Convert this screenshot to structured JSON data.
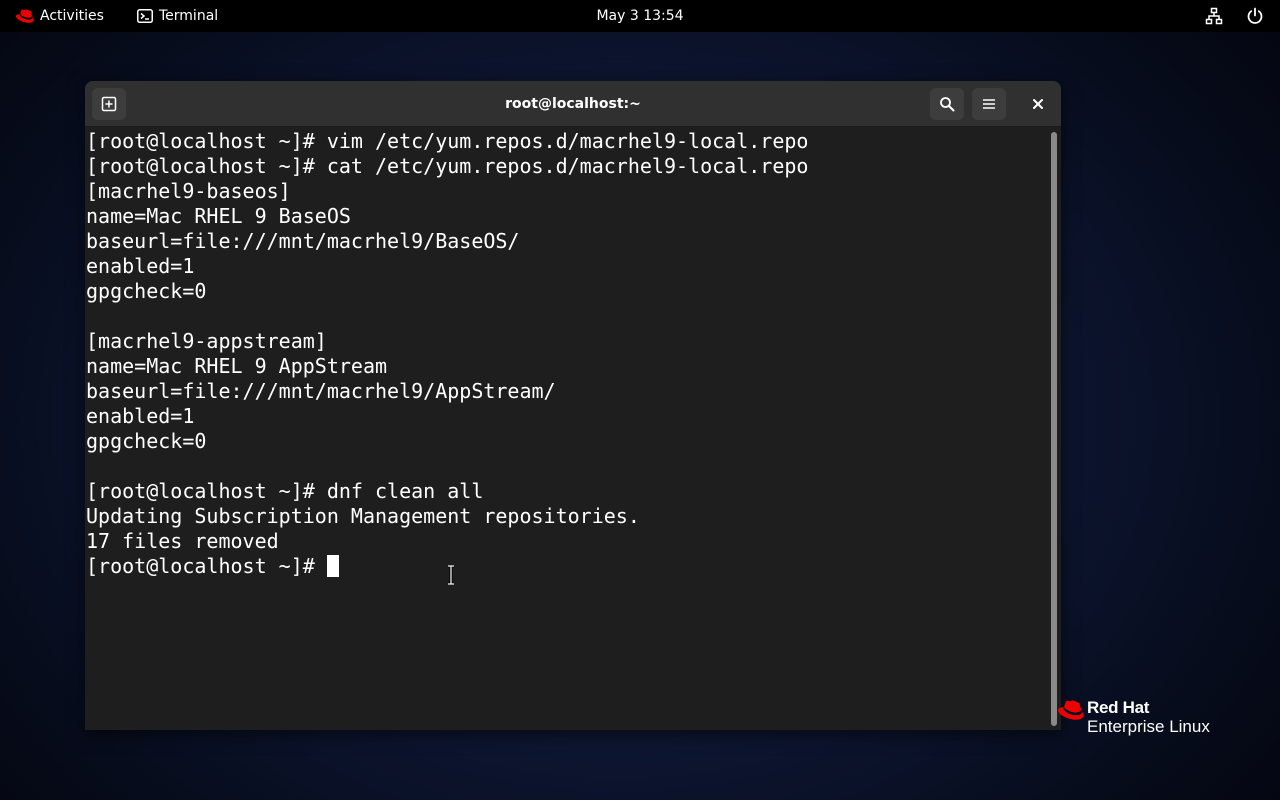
{
  "topbar": {
    "activities_label": "Activities",
    "app_label": "Terminal",
    "clock": "May 3  13:54",
    "icons": [
      "redhat-hat-icon",
      "terminal-app-icon",
      "network-icon",
      "power-icon"
    ]
  },
  "window": {
    "title": "root@localhost:~",
    "buttons": [
      "new-tab-icon",
      "search-icon",
      "hamburger-menu-icon",
      "close-icon"
    ]
  },
  "terminal": {
    "lines": [
      "[root@localhost ~]# vim /etc/yum.repos.d/macrhel9-local.repo",
      "[root@localhost ~]# cat /etc/yum.repos.d/macrhel9-local.repo",
      "[macrhel9-baseos]",
      "name=Mac RHEL 9 BaseOS",
      "baseurl=file:///mnt/macrhel9/BaseOS/",
      "enabled=1",
      "gpgcheck=0",
      "",
      "[macrhel9-appstream]",
      "name=Mac RHEL 9 AppStream",
      "baseurl=file:///mnt/macrhel9/AppStream/",
      "enabled=1",
      "gpgcheck=0",
      "",
      "[root@localhost ~]# dnf clean all",
      "Updating Subscription Management repositories.",
      "17 files removed"
    ],
    "prompt": "[root@localhost ~]# "
  },
  "branding": {
    "brand": "Red Hat",
    "product": "Enterprise Linux",
    "accent_color": "#ee0000"
  }
}
